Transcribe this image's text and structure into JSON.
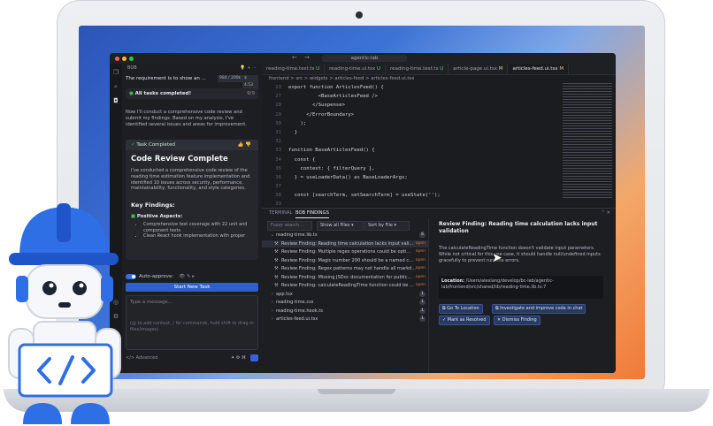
{
  "window": {
    "title": "agentic-lab"
  },
  "chat": {
    "header": "BOB",
    "request": "The requirement is to show an ...",
    "token_count": "984 / 200k",
    "cost": "$ 4.53",
    "tasks_done": "All tasks completed!",
    "tasks_count": "9/9",
    "intro": "Now I'll conduct a comprehensive code review and submit my findings. Based on my analysis, I've identified several issues and areas for improvement.",
    "card_header": "Task Completed",
    "card_title": "Code Review Complete",
    "card_desc": "I've conducted a comprehensive code review of the reading time estimation feature implementation and identified 10 issues across security, performance, maintainability, functionality, and style categories.",
    "key_findings": "Key Findings:",
    "positive": "Positive Aspects:",
    "bullets": [
      "Comprehensive test coverage with 22 unit and component tests",
      "Clean React hook implementation with proper"
    ],
    "auto_approve": "Auto-approve:",
    "new_task": "Start New Task",
    "input_placeholder": "Type a message...",
    "input_hint": "(@ to add context, / for commands, hold shift to drag in files/images)",
    "advanced": "Advanced"
  },
  "editor": {
    "tabs": [
      {
        "label": "reading-time.test.ts",
        "state": "U"
      },
      {
        "label": "reading-time.ui.tsx",
        "state": "U"
      },
      {
        "label": "reading-time.test.ts",
        "state": "U"
      },
      {
        "label": "article-page.ui.tsx",
        "state": "M"
      },
      {
        "label": "articles-feed.ui.tsx",
        "state": "M"
      }
    ],
    "breadcrumb": "frontend > src > widgets > articles-feed > articles-feed.ui.tsx",
    "lines": [
      {
        "n": "23",
        "t": "export function ArticlesFeed() {"
      },
      {
        "n": "27",
        "t": "          <BaseArticlesFeed />"
      },
      {
        "n": "28",
        "t": "        </Suspense>"
      },
      {
        "n": "29",
        "t": "      </ErrorBoundary>"
      },
      {
        "n": "30",
        "t": "    );"
      },
      {
        "n": "31",
        "t": "  }"
      },
      {
        "n": "32",
        "t": ""
      },
      {
        "n": "33",
        "t": "function BaseArticlesFeed() {"
      },
      {
        "n": "34",
        "t": "  const {"
      },
      {
        "n": "35",
        "t": "    context: { filterQuery },"
      },
      {
        "n": "36",
        "t": "  } = useLoaderData() as BaseLoaderArgs;"
      },
      {
        "n": "37",
        "t": ""
      },
      {
        "n": "38",
        "t": "  const [searchTerm, setSearchTerm] = useState('');"
      },
      {
        "n": "39",
        "t": ""
      },
      {
        "n": "40",
        "t": "  const { data, isLoading, isError } = useQuery(articlesQueryOptions(filterQuery));"
      },
      {
        "n": "41",
        "t": ""
      },
      {
        "n": "42",
        "t": "  if (isLoading) return <ArticlesFeedSkeleton />;"
      }
    ]
  },
  "panel": {
    "tabs": [
      "TERMINAL",
      "BOB FINDINGS"
    ],
    "search_placeholder": "Fuzzy search...",
    "filter": "Show all Files",
    "sort": "Sort by File",
    "rows": [
      {
        "kind": "file",
        "label": "reading-time.lib.ts",
        "badge": "6",
        "expanded": true
      },
      {
        "kind": "finding",
        "label": "Review Finding: Reading time calculation lacks input vali...",
        "status": "open",
        "selected": true
      },
      {
        "kind": "finding",
        "label": "Review Finding: Multiple regex operations could be opti...",
        "status": "open"
      },
      {
        "kind": "finding",
        "label": "Review Finding: Magic number 200 should be a named c...",
        "status": "open"
      },
      {
        "kind": "finding",
        "label": "Review Finding: Regex patterns may not handle all markd...",
        "status": "open"
      },
      {
        "kind": "finding",
        "label": "Review Finding: Missing JSDoc documentation for public...",
        "status": "open"
      },
      {
        "kind": "finding",
        "label": "Review Finding: calculateReadingTime function could be ...",
        "status": "open"
      },
      {
        "kind": "file",
        "label": "app.tsx",
        "badge": "1"
      },
      {
        "kind": "file",
        "label": "reading-time.css",
        "badge": "1"
      },
      {
        "kind": "file",
        "label": "reading-time.hook.ts",
        "badge": "1"
      },
      {
        "kind": "file",
        "label": "articles-feed.ui.tsx",
        "badge": "1"
      }
    ],
    "detail": {
      "title": "Review Finding: Reading time calculation lacks input validation",
      "text": "The calculateReadingTime function doesn't validate input parameters. While not critical for this use case, it should handle null/undefined inputs gracefully to prevent runtime errors.",
      "location_label": "Location:",
      "location": "/Users/alexlang/develop/bc-lab/agentic-lab/frontend/src/shared/lib/reading-time.lib.ts:7",
      "buttons": [
        "Go To Location",
        "Investigate and improve code in chat",
        "Mark as Resolved",
        "Dismiss Finding"
      ]
    }
  },
  "colors": {
    "accent": "#2f5fd1",
    "open_status": "#e0753d",
    "robot_blue": "#2f6fe6"
  }
}
